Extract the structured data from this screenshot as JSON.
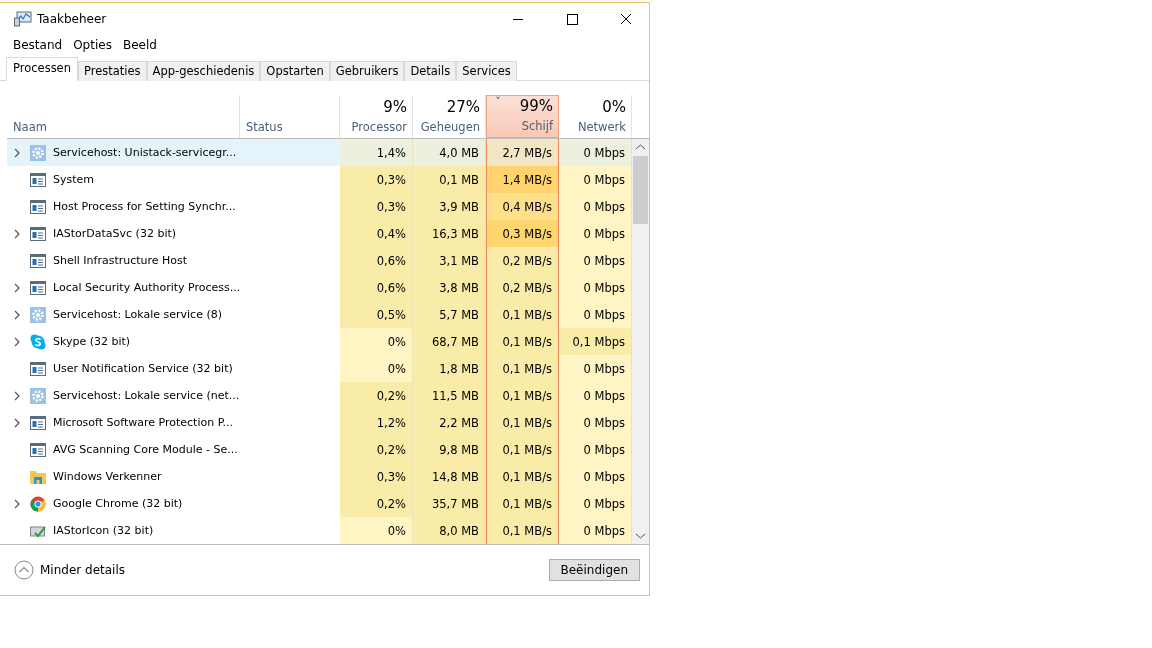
{
  "window": {
    "title": "Taakbeheer"
  },
  "menu": [
    "Bestand",
    "Opties",
    "Beeld"
  ],
  "tabs": [
    {
      "label": "Processen",
      "selected": true
    },
    {
      "label": "Prestaties",
      "selected": false
    },
    {
      "label": "App-geschiedenis",
      "selected": false
    },
    {
      "label": "Opstarten",
      "selected": false
    },
    {
      "label": "Gebruikers",
      "selected": false
    },
    {
      "label": "Details",
      "selected": false
    },
    {
      "label": "Services",
      "selected": false
    }
  ],
  "columns": [
    {
      "label": "Naam",
      "sorted": false
    },
    {
      "label": "Status",
      "sorted": false
    },
    {
      "label": "Processor",
      "total": "9%",
      "sorted": false
    },
    {
      "label": "Geheugen",
      "total": "27%",
      "sorted": false
    },
    {
      "label": "Schijf",
      "total": "99%",
      "sorted": true,
      "sort_arrow": "ˇ"
    },
    {
      "label": "Netwerk",
      "total": "0%",
      "sorted": false
    }
  ],
  "rows": [
    {
      "name": "Servicehost: Unistack-servicegr...",
      "kind": "gear",
      "expandable": true,
      "selected": true,
      "cells": [
        {
          "text": "1,4%",
          "color": "#eef0df"
        },
        {
          "text": "4,0 MB",
          "color": "#eef0df"
        },
        {
          "text": "2,7 MB/s",
          "color": "#f2e6c4"
        },
        {
          "text": "0 Mbps",
          "color": "#eef0df"
        }
      ]
    },
    {
      "name": "System",
      "kind": "window",
      "expandable": false,
      "selected": false,
      "cells": [
        {
          "text": "0,3%",
          "color": "#f9eca8"
        },
        {
          "text": "0,1 MB",
          "color": "#f9eca8"
        },
        {
          "text": "1,4 MB/s",
          "color": "#ffd36e"
        },
        {
          "text": "0 Mbps",
          "color": "#fff4c4"
        }
      ]
    },
    {
      "name": "Host Process for Setting Synchr...",
      "kind": "window",
      "expandable": false,
      "selected": false,
      "cells": [
        {
          "text": "0,3%",
          "color": "#f9eca8"
        },
        {
          "text": "3,9 MB",
          "color": "#f9eca8"
        },
        {
          "text": "0,4 MB/s",
          "color": "#ffe08a"
        },
        {
          "text": "0 Mbps",
          "color": "#fff4c4"
        }
      ]
    },
    {
      "name": "IAStorDataSvc (32 bit)",
      "kind": "window",
      "expandable": true,
      "selected": false,
      "cells": [
        {
          "text": "0,4%",
          "color": "#f9eca8"
        },
        {
          "text": "16,3 MB",
          "color": "#f9eca8"
        },
        {
          "text": "0,3 MB/s",
          "color": "#ffd570"
        },
        {
          "text": "0 Mbps",
          "color": "#fff4c4"
        }
      ]
    },
    {
      "name": "Shell Infrastructure Host",
      "kind": "window",
      "expandable": false,
      "selected": false,
      "cells": [
        {
          "text": "0,6%",
          "color": "#f9eca8"
        },
        {
          "text": "3,1 MB",
          "color": "#f9eca8"
        },
        {
          "text": "0,2 MB/s",
          "color": "#f9eca8"
        },
        {
          "text": "0 Mbps",
          "color": "#fff4c4"
        }
      ]
    },
    {
      "name": "Local Security Authority Process...",
      "kind": "window",
      "expandable": true,
      "selected": false,
      "cells": [
        {
          "text": "0,6%",
          "color": "#f9eca8"
        },
        {
          "text": "3,8 MB",
          "color": "#f9eca8"
        },
        {
          "text": "0,2 MB/s",
          "color": "#f9eca8"
        },
        {
          "text": "0 Mbps",
          "color": "#fff4c4"
        }
      ]
    },
    {
      "name": "Servicehost: Lokale service (8)",
      "kind": "gear",
      "expandable": true,
      "selected": false,
      "cells": [
        {
          "text": "0,5%",
          "color": "#f9eca8"
        },
        {
          "text": "5,7 MB",
          "color": "#f9eca8"
        },
        {
          "text": "0,1 MB/s",
          "color": "#f9eca8"
        },
        {
          "text": "0 Mbps",
          "color": "#fff4c4"
        }
      ]
    },
    {
      "name": "Skype (32 bit)",
      "kind": "skype",
      "expandable": true,
      "selected": false,
      "cells": [
        {
          "text": "0%",
          "color": "#fff4c4"
        },
        {
          "text": "68,7 MB",
          "color": "#f9eca8"
        },
        {
          "text": "0,1 MB/s",
          "color": "#f9eca8"
        },
        {
          "text": "0,1 Mbps",
          "color": "#f9eca8"
        }
      ]
    },
    {
      "name": "User Notification Service (32 bit)",
      "kind": "window",
      "expandable": false,
      "selected": false,
      "cells": [
        {
          "text": "0%",
          "color": "#fff4c4"
        },
        {
          "text": "1,8 MB",
          "color": "#f9eca8"
        },
        {
          "text": "0,1 MB/s",
          "color": "#f9eca8"
        },
        {
          "text": "0 Mbps",
          "color": "#fff4c4"
        }
      ]
    },
    {
      "name": "Servicehost: Lokale service (net...",
      "kind": "gear",
      "expandable": true,
      "selected": false,
      "cells": [
        {
          "text": "0,2%",
          "color": "#f9eca8"
        },
        {
          "text": "11,5 MB",
          "color": "#f9eca8"
        },
        {
          "text": "0,1 MB/s",
          "color": "#f9eca8"
        },
        {
          "text": "0 Mbps",
          "color": "#fff4c4"
        }
      ]
    },
    {
      "name": "Microsoft Software Protection P...",
      "kind": "window",
      "expandable": true,
      "selected": false,
      "cells": [
        {
          "text": "1,2%",
          "color": "#f9eca8"
        },
        {
          "text": "2,2 MB",
          "color": "#f9eca8"
        },
        {
          "text": "0,1 MB/s",
          "color": "#f9eca8"
        },
        {
          "text": "0 Mbps",
          "color": "#fff4c4"
        }
      ]
    },
    {
      "name": "AVG Scanning Core Module - Se...",
      "kind": "window",
      "expandable": false,
      "selected": false,
      "cells": [
        {
          "text": "0,2%",
          "color": "#f9eca8"
        },
        {
          "text": "9,8 MB",
          "color": "#f9eca8"
        },
        {
          "text": "0,1 MB/s",
          "color": "#f9eca8"
        },
        {
          "text": "0 Mbps",
          "color": "#fff4c4"
        }
      ]
    },
    {
      "name": "Windows Verkenner",
      "kind": "folder",
      "expandable": false,
      "selected": false,
      "cells": [
        {
          "text": "0,3%",
          "color": "#f9eca8"
        },
        {
          "text": "14,8 MB",
          "color": "#f9eca8"
        },
        {
          "text": "0,1 MB/s",
          "color": "#f9eca8"
        },
        {
          "text": "0 Mbps",
          "color": "#fff4c4"
        }
      ]
    },
    {
      "name": "Google Chrome (32 bit)",
      "kind": "chrome",
      "expandable": true,
      "selected": false,
      "cells": [
        {
          "text": "0,2%",
          "color": "#f9eca8"
        },
        {
          "text": "35,7 MB",
          "color": "#f9eca8"
        },
        {
          "text": "0,1 MB/s",
          "color": "#f9eca8"
        },
        {
          "text": "0 Mbps",
          "color": "#fff4c4"
        }
      ]
    },
    {
      "name": "IAStorIcon (32 bit)",
      "kind": "check",
      "expandable": false,
      "selected": false,
      "cells": [
        {
          "text": "0%",
          "color": "#fff4c4"
        },
        {
          "text": "8,0 MB",
          "color": "#f9eca8"
        },
        {
          "text": "0,1 MB/s",
          "color": "#f9eca8"
        },
        {
          "text": "0 Mbps",
          "color": "#fff4c4"
        }
      ]
    }
  ],
  "footer": {
    "toggle": "Minder details",
    "button": "Beëindigen"
  }
}
